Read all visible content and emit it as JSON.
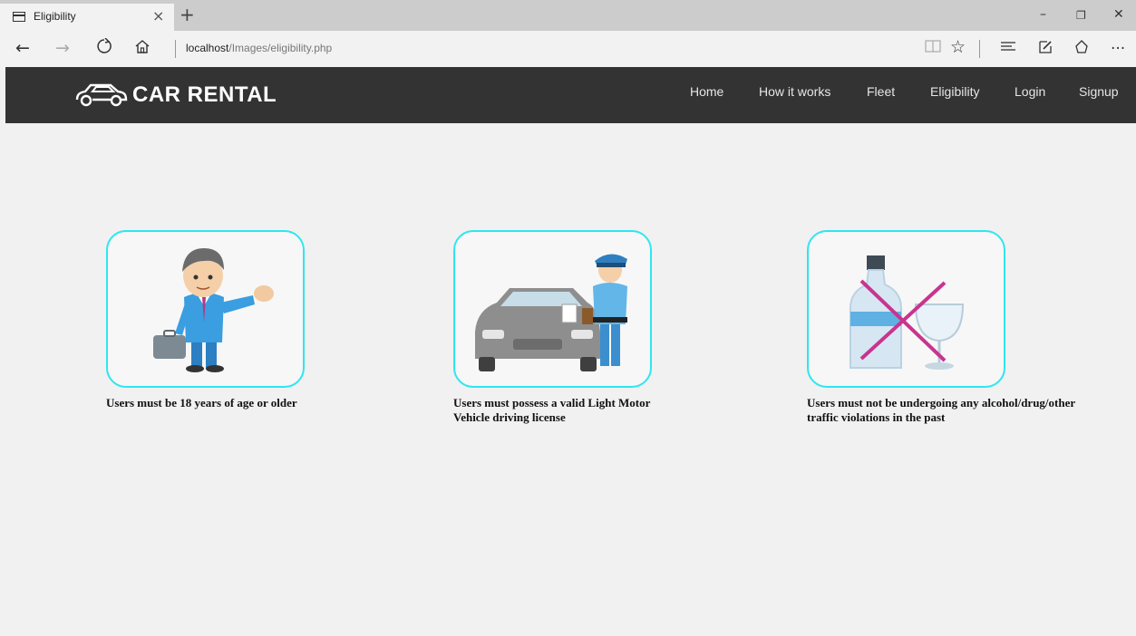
{
  "browser": {
    "tab_title": "Eligibility",
    "tab_close": "×",
    "new_tab": "+",
    "url_host": "localhost",
    "url_path": "/Images/eligibility.php",
    "window_controls": {
      "minimize": "–",
      "restore": "❐",
      "close": "✕"
    },
    "toolbar_icons": [
      "reading-view-icon",
      "favorite-star-icon",
      "hub-icon",
      "web-note-icon",
      "share-icon",
      "more-icon"
    ]
  },
  "site": {
    "logo_text": "CAR RENTAL",
    "menu": [
      {
        "label": "Home"
      },
      {
        "label": "How it works"
      },
      {
        "label": "Fleet"
      },
      {
        "label": "Eligibility"
      },
      {
        "label": "Login"
      },
      {
        "label": "Signup"
      }
    ]
  },
  "requirements": [
    {
      "icon": "businessman-illustration",
      "caption": "Users must be 18 years of age or older"
    },
    {
      "icon": "police-car-license-illustration",
      "caption": "Users must possess a valid Light Motor Vehicle driving license"
    },
    {
      "icon": "no-alcohol-illustration",
      "caption": "Users must not be undergoing any alcohol/drug/other traffic violations in the past"
    }
  ],
  "colors": {
    "navbar": "#333333",
    "card_border": "#2ee6f0",
    "page_bg": "#f1f1f1"
  }
}
